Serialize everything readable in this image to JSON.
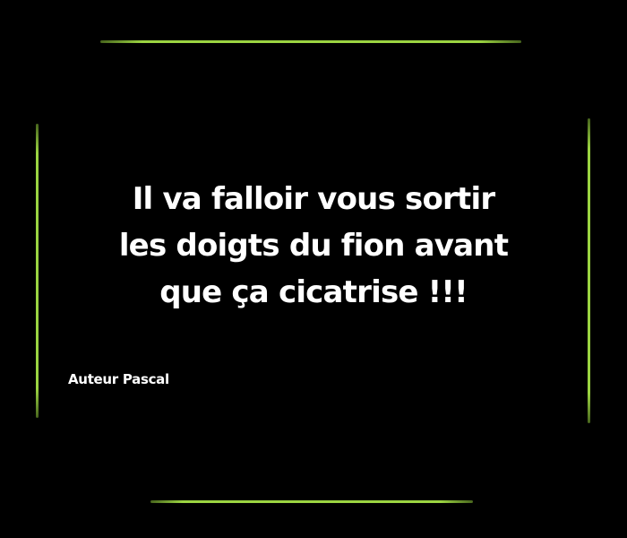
{
  "quote": {
    "lines": [
      "Il va falloir vous sortir",
      "les doigts du fion avant",
      "que ça cicatrise !!!"
    ]
  },
  "author": "Auteur Pascal",
  "colors": {
    "background": "#000000",
    "accent": "#9bd441",
    "text": "#ffffff"
  }
}
